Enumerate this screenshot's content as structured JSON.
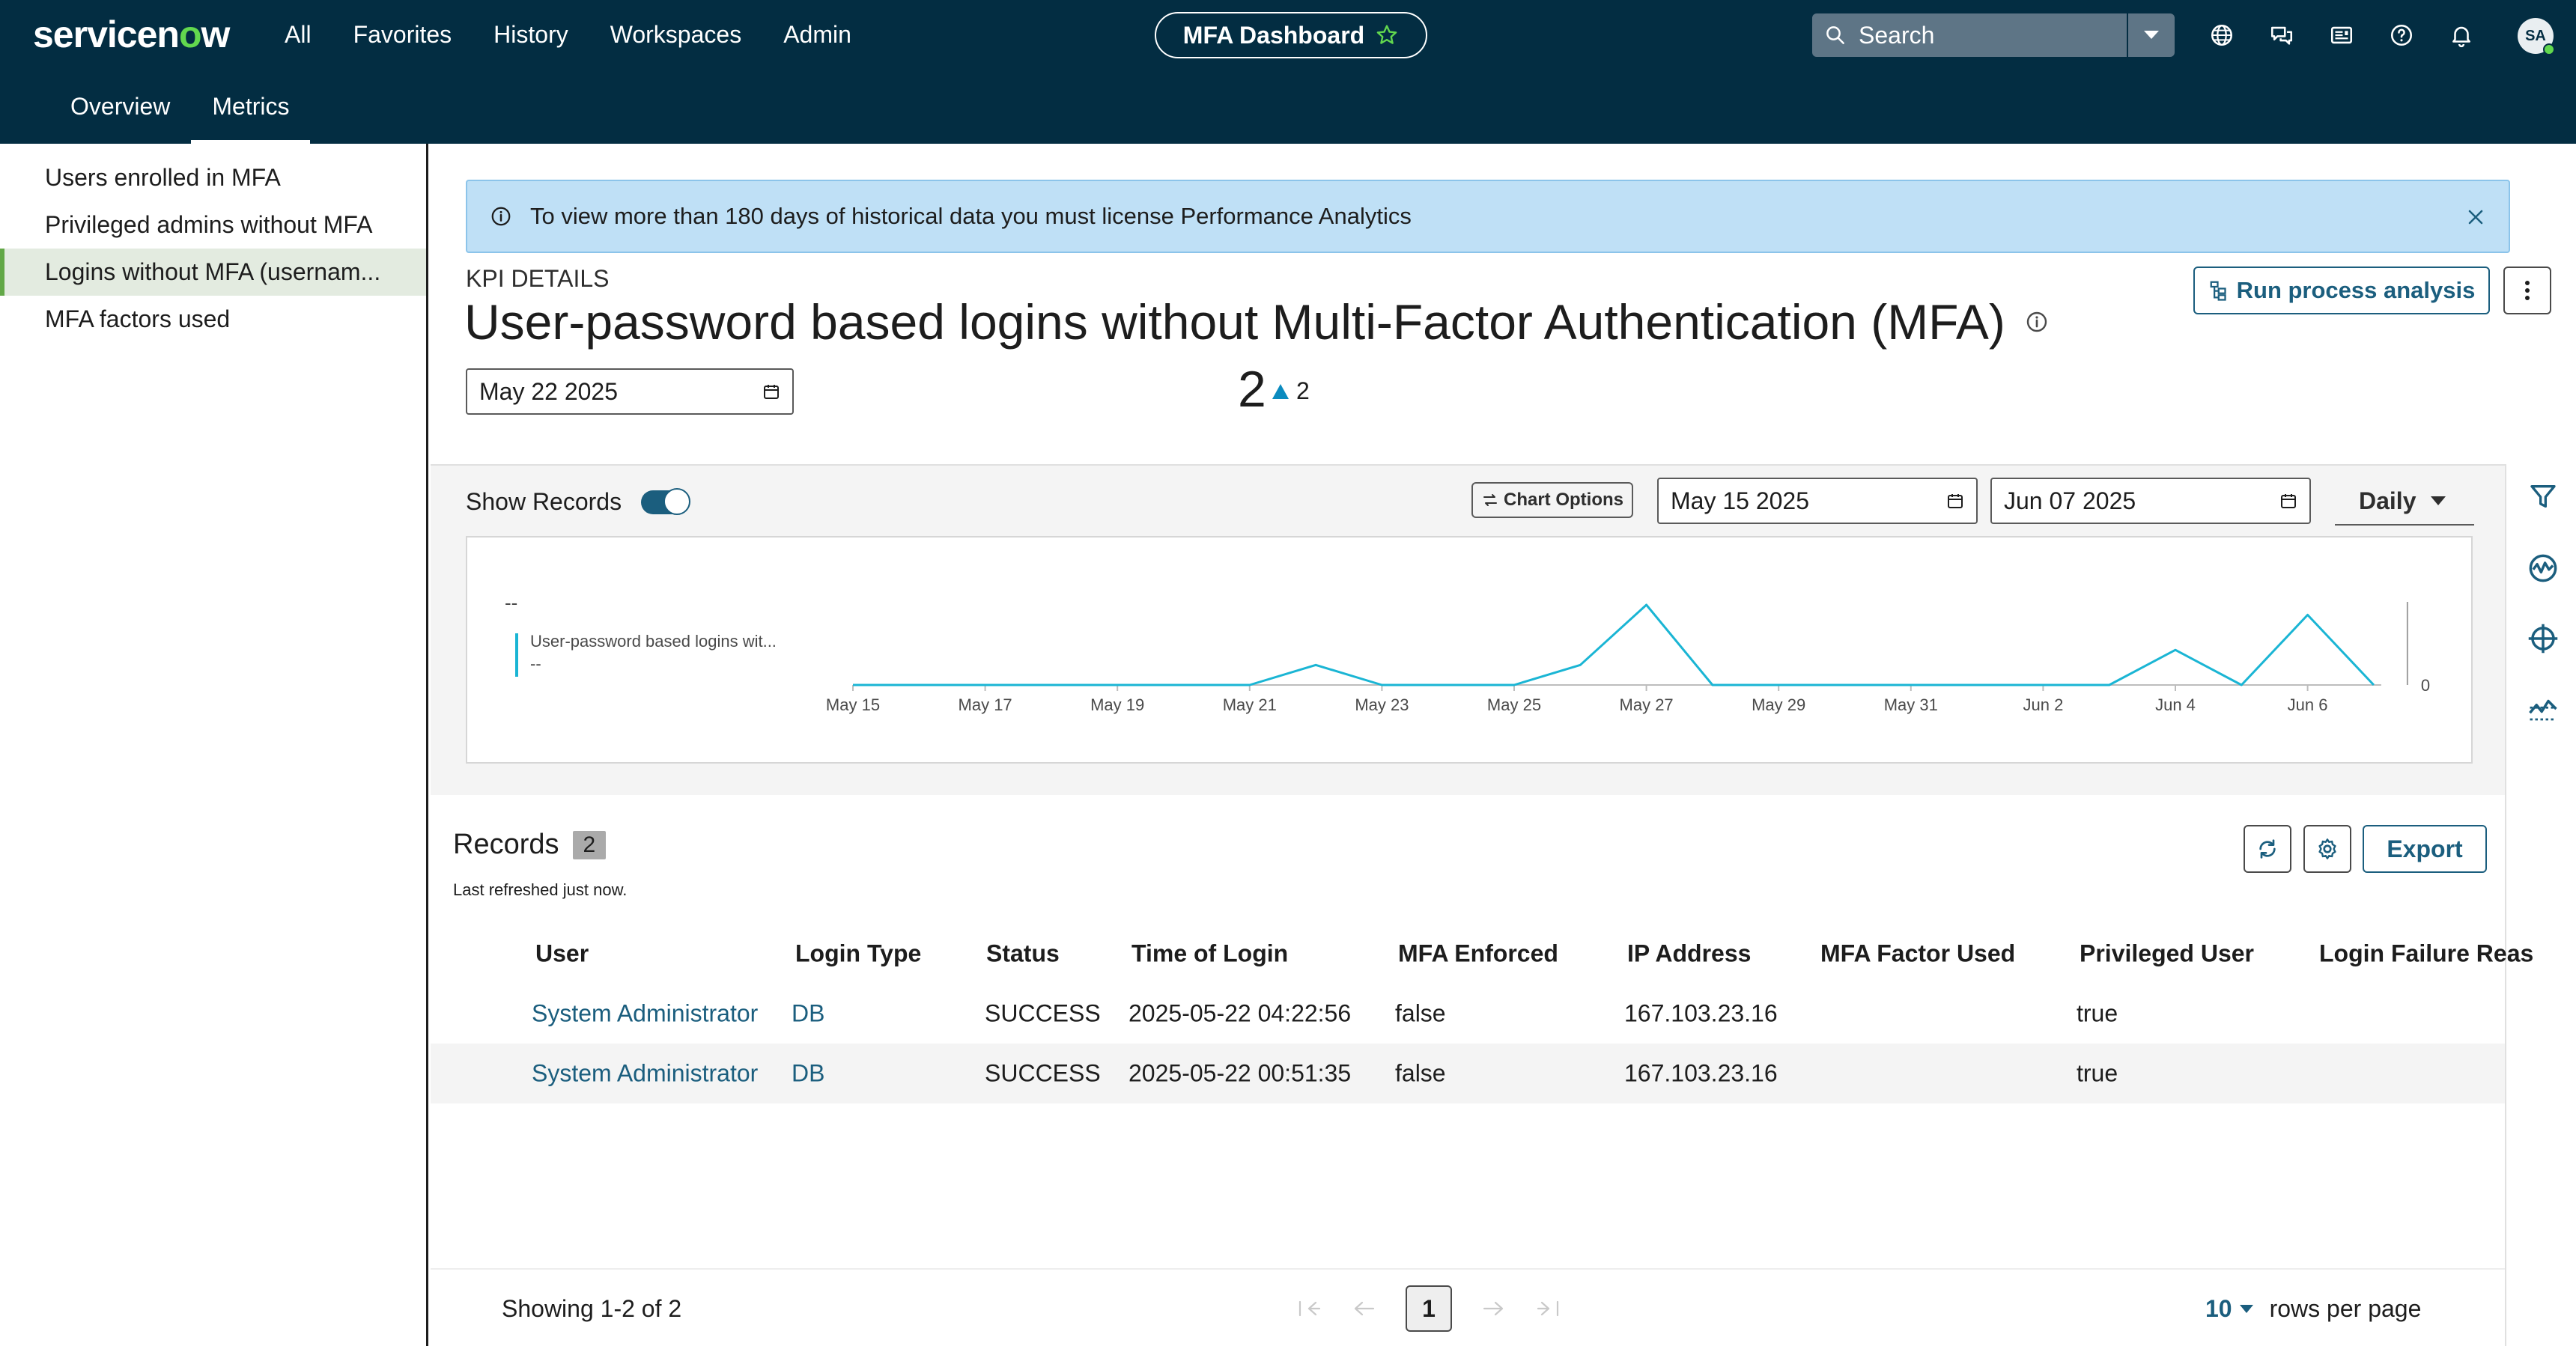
{
  "app": {
    "logo_prefix": "servicen",
    "logo_o": "o",
    "logo_suffix": "w",
    "nav": [
      "All",
      "Favorites",
      "History",
      "Workspaces",
      "Admin"
    ],
    "dashboard_title": "MFA Dashboard",
    "search_placeholder": "Search",
    "avatar_initials": "SA"
  },
  "subtabs": [
    {
      "label": "Overview",
      "active": false
    },
    {
      "label": "Metrics",
      "active": true
    }
  ],
  "sidebar": {
    "items": [
      {
        "label": "Users enrolled in MFA",
        "active": false
      },
      {
        "label": "Privileged admins without MFA",
        "active": false
      },
      {
        "label": "Logins without MFA (usernam...",
        "active": true
      },
      {
        "label": "MFA factors used",
        "active": false
      }
    ]
  },
  "banner": {
    "text": "To view more than 180 days of historical data you must license Performance Analytics"
  },
  "kpi": {
    "section_label": "KPI DETAILS",
    "title": "User-password based logins without Multi-Factor Authentication (MFA)",
    "run_label": "Run process analysis",
    "date": "May 22 2025",
    "value": "2",
    "delta": "2"
  },
  "chart_controls": {
    "show_records_label": "Show Records",
    "chart_options_label": "Chart Options",
    "start_date": "May 15 2025",
    "end_date": "Jun 07 2025",
    "interval": "Daily"
  },
  "chart_data": {
    "type": "line",
    "legend_placeholder_top": "--",
    "legend_series_label": "User-password based logins wit...",
    "legend_series_value": "--",
    "x_ticks": [
      "May 15",
      "May 17",
      "May 19",
      "May 21",
      "May 23",
      "May 25",
      "May 27",
      "May 29",
      "May 31",
      "Jun 2",
      "Jun 4",
      "Jun 6"
    ],
    "y_tick_labels": [
      "0"
    ],
    "series": [
      {
        "x": [
          "May 15",
          "May 16",
          "May 17",
          "May 18",
          "May 19",
          "May 20",
          "May 21",
          "May 22",
          "May 23",
          "May 24",
          "May 25",
          "May 26",
          "May 27",
          "May 28",
          "May 29",
          "May 30",
          "May 31",
          "Jun 1",
          "Jun 2",
          "Jun 3",
          "Jun 4",
          "Jun 5",
          "Jun 6",
          "Jun 7"
        ],
        "values": [
          0,
          0,
          0,
          0,
          0,
          0,
          0,
          2,
          0,
          0,
          0,
          2,
          8,
          0,
          0,
          0,
          0,
          0,
          0,
          0,
          3.5,
          0,
          7,
          0
        ],
        "color": "#1ab5d4"
      }
    ],
    "ylim": [
      0,
      8
    ]
  },
  "records": {
    "title": "Records",
    "count": "2",
    "refreshed": "Last refreshed just now.",
    "export_label": "Export",
    "columns": [
      "User",
      "Login Type",
      "Status",
      "Time of Login",
      "MFA Enforced",
      "IP Address",
      "MFA Factor Used",
      "Privileged User",
      "Login Failure Reas"
    ],
    "rows": [
      [
        "System Administrator",
        "DB",
        "SUCCESS",
        "2025-05-22 04:22:56",
        "false",
        "167.103.23.16",
        "",
        "true",
        ""
      ],
      [
        "System Administrator",
        "DB",
        "SUCCESS",
        "2025-05-22 00:51:35",
        "false",
        "167.103.23.16",
        "",
        "true",
        ""
      ]
    ]
  },
  "pagination": {
    "showing": "Showing 1-2 of 2",
    "page": "1",
    "rows_per_page_value": "10",
    "rows_per_page_label": "rows per page"
  },
  "colors": {
    "header_bg": "#032d42",
    "accent": "#1b5e7e",
    "brand_green": "#62d84e",
    "banner_bg": "#bfe0f6",
    "chart_line": "#1ab5d4"
  }
}
